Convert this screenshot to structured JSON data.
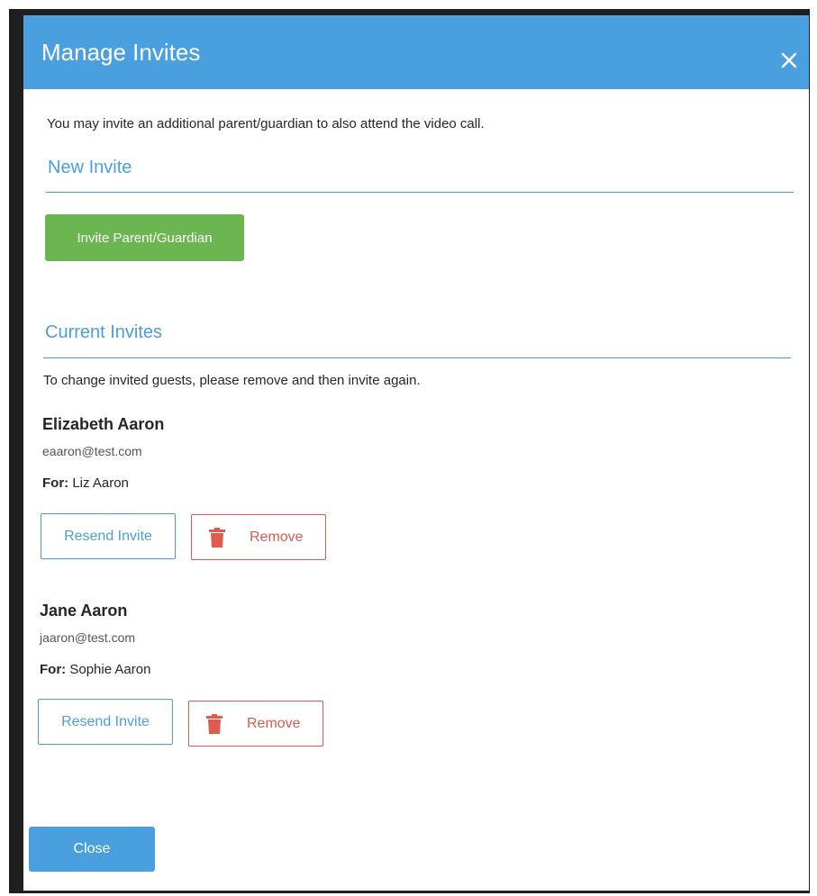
{
  "modal": {
    "title": "Manage Invites",
    "close_icon": "close-icon",
    "intro_text": "You may invite an additional parent/guardian to also attend the video call.",
    "new_invite_heading": "New Invite",
    "invite_button_label": "Invite Parent/Guardian",
    "current_invites_heading": "Current Invites",
    "change_note": "To change invited guests, please remove and then invite again.",
    "guests": [
      {
        "name": "Elizabeth Aaron",
        "email": "eaaron@test.com",
        "for_label": "For:",
        "for_value": "Liz Aaron",
        "resend_label": "Resend Invite",
        "remove_label": "Remove"
      },
      {
        "name": "Jane Aaron",
        "email": "jaaron@test.com",
        "for_label": "For:",
        "for_value": "Sophie Aaron",
        "resend_label": "Resend Invite",
        "remove_label": "Remove"
      }
    ],
    "close_button_label": "Close"
  },
  "colors": {
    "header": "#4a9fde",
    "accent": "#4a9fde",
    "invite_button": "#6cb652",
    "remove": "#e05a4f"
  },
  "icons": {
    "close": "close-icon",
    "remove": "trash-icon"
  }
}
